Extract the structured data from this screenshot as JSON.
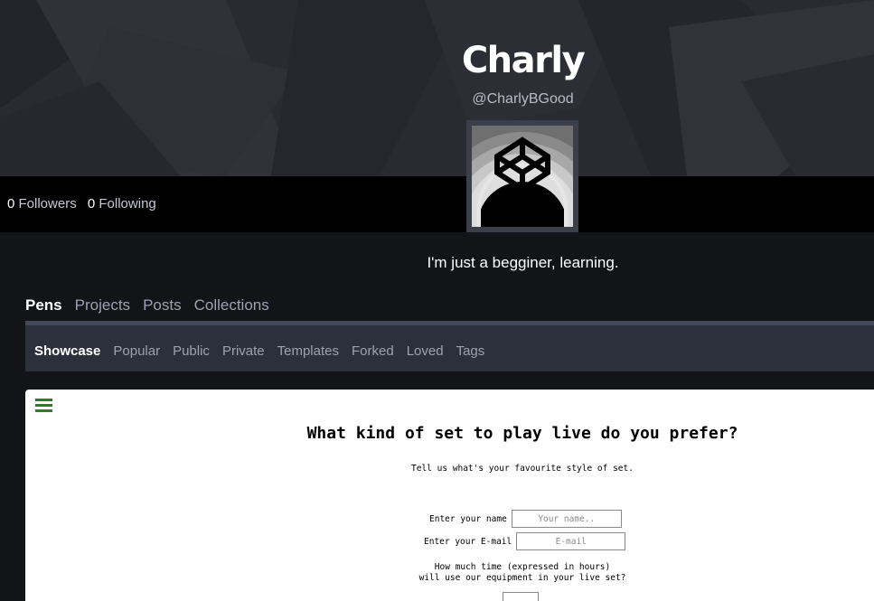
{
  "profile": {
    "name": "Charly",
    "handle": "@CharlyBGood",
    "bio": "I'm just a begginer, learning."
  },
  "stats": {
    "followers_count": "0",
    "followers_label": "Followers",
    "following_count": "0",
    "following_label": "Following"
  },
  "tabs": [
    {
      "label": "Pens",
      "active": true
    },
    {
      "label": "Projects",
      "active": false
    },
    {
      "label": "Posts",
      "active": false
    },
    {
      "label": "Collections",
      "active": false
    }
  ],
  "subtabs": [
    {
      "label": "Showcase",
      "active": true
    },
    {
      "label": "Popular",
      "active": false
    },
    {
      "label": "Public",
      "active": false
    },
    {
      "label": "Private",
      "active": false
    },
    {
      "label": "Templates",
      "active": false
    },
    {
      "label": "Forked",
      "active": false
    },
    {
      "label": "Loved",
      "active": false
    },
    {
      "label": "Tags",
      "active": false
    }
  ],
  "pen_preview": {
    "title": "What kind of set to play live do you prefer?",
    "subtitle": "Tell us what's your favourite style of set.",
    "name_label": "Enter your name",
    "name_placeholder": "Your name..",
    "email_label": "Enter your E-mail",
    "email_placeholder": "E-mail",
    "question_line1": "How much time (expressed in hours)",
    "question_line2": "will use our equipment in your live set?"
  },
  "colors": {
    "page_bg": "#131417",
    "banner_bg": "#2a2b31",
    "stats_bar_bg": "#000000",
    "subnav_bg": "#2c303a",
    "menu_icon": "#2e7d2e"
  }
}
